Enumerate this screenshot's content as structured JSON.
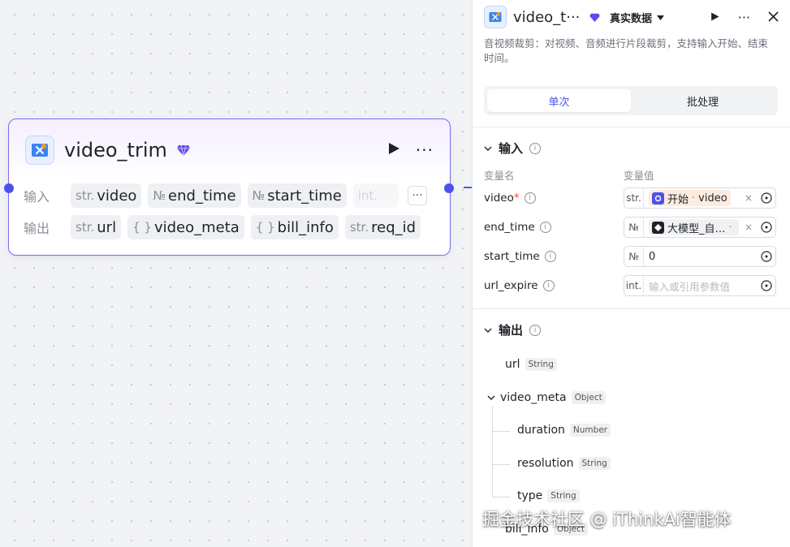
{
  "node": {
    "title": "video_trim",
    "inputs_label": "输入",
    "outputs_label": "输出",
    "inputs": [
      {
        "type": "str.",
        "name": "video"
      },
      {
        "type": "№",
        "name": "end_time"
      },
      {
        "type": "№",
        "name": "start_time"
      },
      {
        "type": "int.",
        "name": ""
      }
    ],
    "outputs": [
      {
        "type": "str.",
        "name": "url"
      },
      {
        "type": "{ }",
        "name": "video_meta"
      },
      {
        "type": "{ }",
        "name": "bill_info"
      },
      {
        "type": "str.",
        "name": "req_id"
      }
    ],
    "more_label": "···"
  },
  "panel": {
    "title": "video_t···",
    "data_mode": "真实数据",
    "description": "音视频裁剪：对视频、音频进行片段裁剪，支持输入开始、结束时间。",
    "tabs": [
      {
        "label": "单次",
        "active": true
      },
      {
        "label": "批处理",
        "active": false
      }
    ],
    "input_section": "输入",
    "col_name": "变量名",
    "col_value": "变量值",
    "inputs": [
      {
        "name": "video",
        "required": "*",
        "type": "str.",
        "ref_source": "开始",
        "ref_sep": " · ",
        "ref_var": "video"
      },
      {
        "name": "end_time",
        "type": "№",
        "ref_source": "大模型_自…",
        "ref_sep": " · ",
        "ref_var": ""
      },
      {
        "name": "start_time",
        "type": "№",
        "value": "0"
      },
      {
        "name": "url_expire",
        "type": "int.",
        "placeholder": "输入或引用参数值"
      }
    ],
    "output_section": "输出",
    "outputs": [
      {
        "name": "url",
        "type": "String"
      },
      {
        "name": "video_meta",
        "type": "Object"
      },
      {
        "name": "duration",
        "type": "Number"
      },
      {
        "name": "resolution",
        "type": "String"
      },
      {
        "name": "type",
        "type": "String"
      },
      {
        "name": "bill_info",
        "type": "Object"
      }
    ]
  },
  "watermark": "掘金技术社区 @ iThinkAi智能体",
  "colors": {
    "accent": "#4d53e8",
    "node_border": "#7a6cf0",
    "required": "#f54a45"
  }
}
